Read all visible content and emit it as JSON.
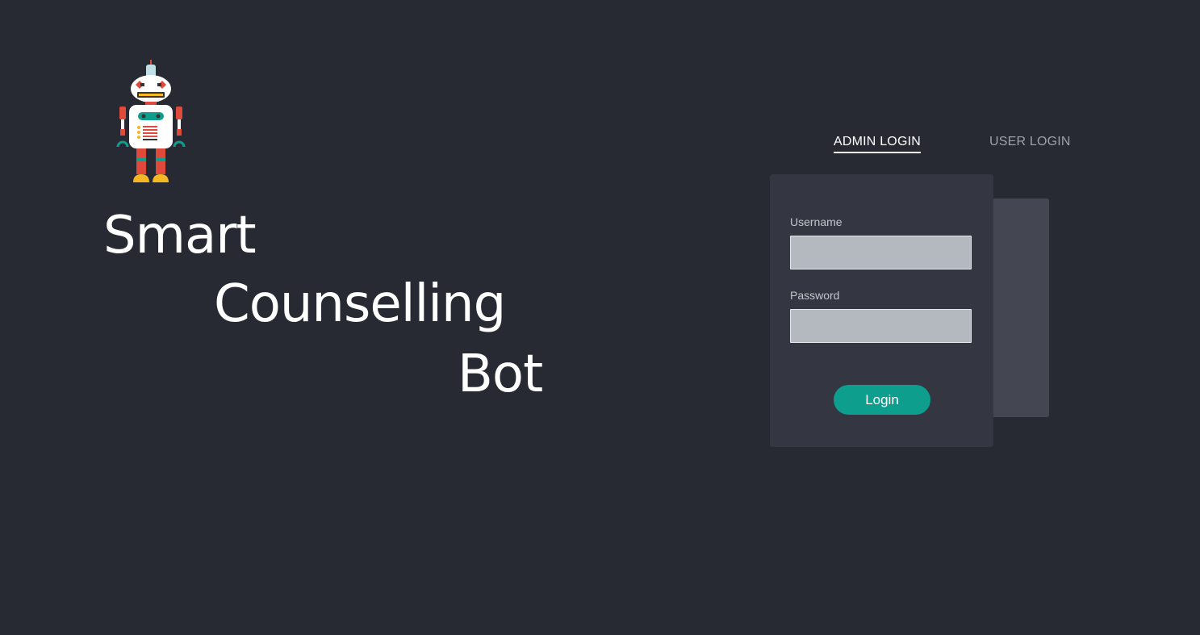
{
  "app_title": {
    "line1": "Smart",
    "line2": "Counselling",
    "line3": "Bot"
  },
  "logo": {
    "icon": "robot-icon"
  },
  "tabs": [
    {
      "label": "ADMIN LOGIN",
      "active": true
    },
    {
      "label": "USER LOGIN",
      "active": false
    }
  ],
  "form": {
    "username_label": "Username",
    "username_value": "",
    "password_label": "Password",
    "password_value": "",
    "login_label": "Login"
  },
  "colors": {
    "background": "#272a33",
    "card": "#343641",
    "accent": "#0e9e8e",
    "input": "#b4b9c0"
  }
}
